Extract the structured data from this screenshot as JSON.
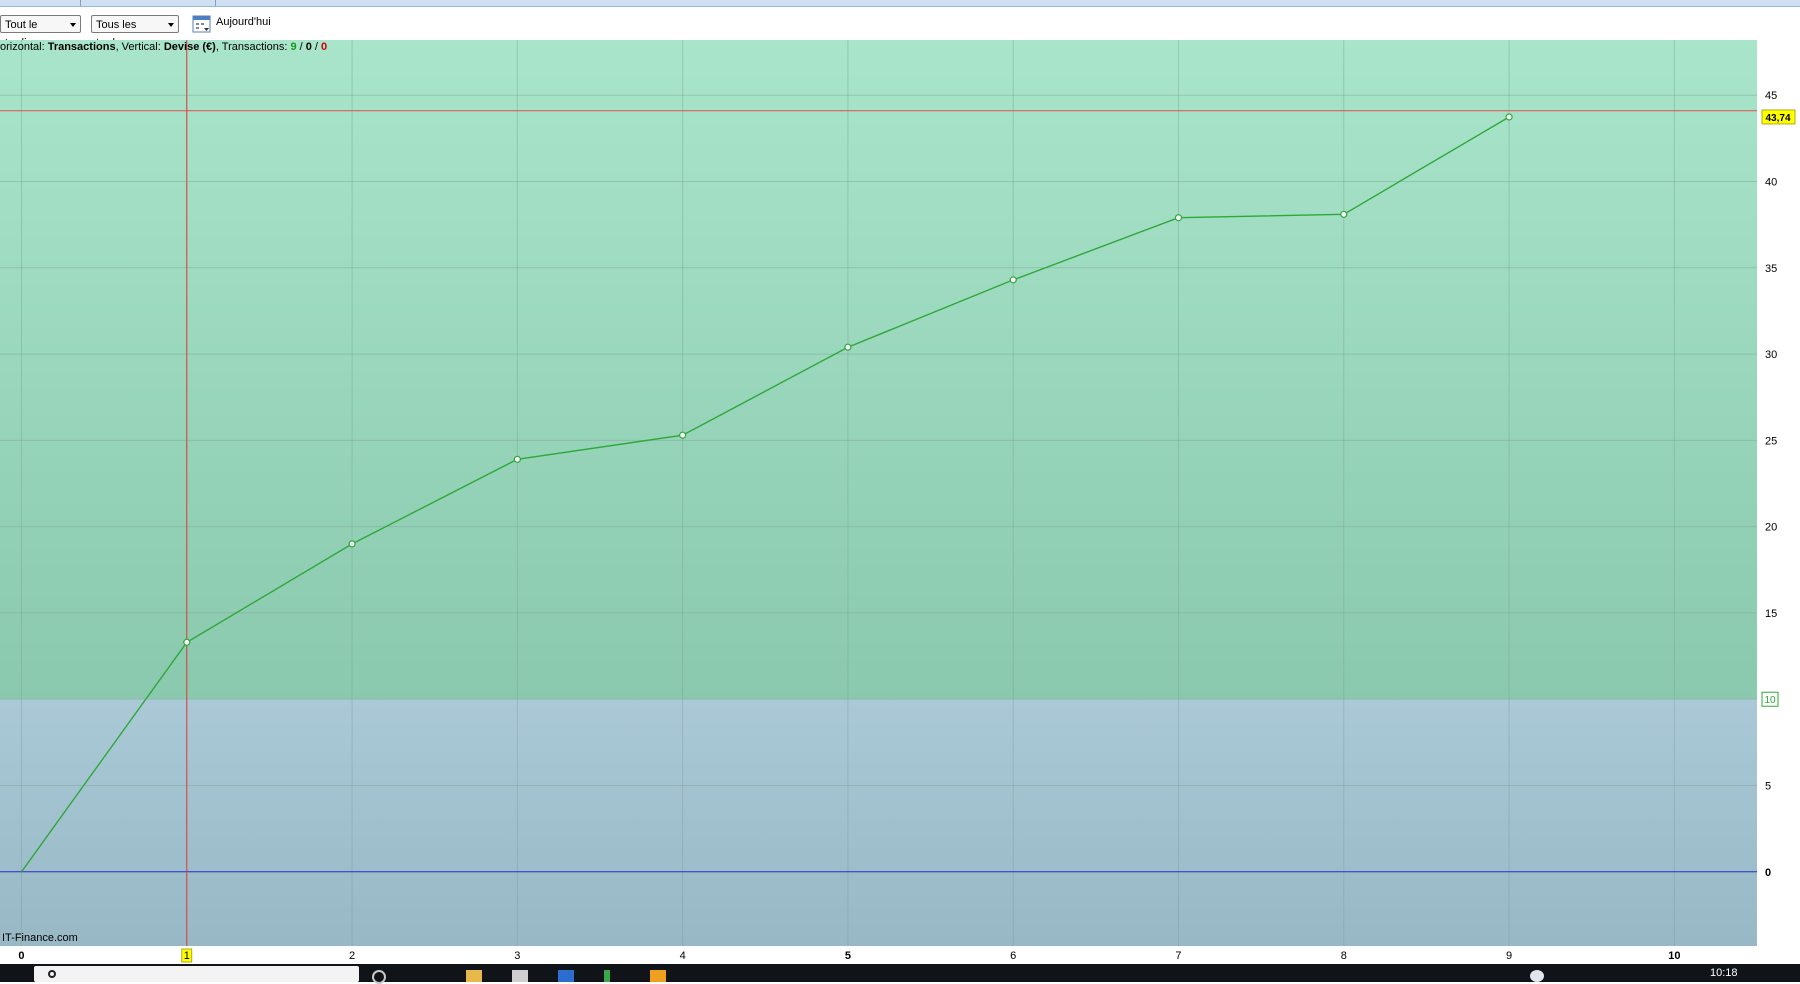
{
  "toolbar": {
    "scope_dropdown": "Tout le trading",
    "trades_dropdown": "Tous les trades",
    "date_label": "Aujourd'hui"
  },
  "chart_info": {
    "prefix": "orizontal: ",
    "horizontal_value": "Transactions",
    "vertical_label": ", Vertical: ",
    "vertical_value": "Devise (€)",
    "transactions_label": ", Transactions: ",
    "count_total": "9",
    "sep1": " / ",
    "count_neutral": "0",
    "sep2": " / ",
    "count_negative": "0"
  },
  "watermark": "IT-Finance.com",
  "colors": {
    "zone_positive_top": "#a9e5cb",
    "zone_positive_bottom": "#8ac9ae",
    "zone_below_top": "#aac9d7",
    "zone_below_bottom": "#98b8c6",
    "series": "#2fa83a",
    "last_value_line": "#e05050",
    "zero_line": "#2233cc",
    "crosshair": "#e03c3c",
    "label_highlight": "#ffff00",
    "positive_count": "#1a9a1a",
    "negative_count": "#cc0000"
  },
  "chart_data": {
    "type": "line",
    "title": "",
    "xlabel": "Transactions",
    "ylabel": "Devise (€)",
    "x": [
      0,
      1,
      2,
      3,
      4,
      5,
      6,
      7,
      8,
      9
    ],
    "values": [
      0,
      13.3,
      19.0,
      23.9,
      25.3,
      30.4,
      34.3,
      37.9,
      38.1,
      43.74
    ],
    "xlim": [
      -0.13,
      10.5
    ],
    "ylim": [
      -4.3,
      48.2
    ],
    "xticks": [
      {
        "value": 0,
        "label": "0",
        "bold": true
      },
      {
        "value": 1,
        "label": "1",
        "highlight": true
      },
      {
        "value": 2,
        "label": "2"
      },
      {
        "value": 3,
        "label": "3"
      },
      {
        "value": 4,
        "label": "4"
      },
      {
        "value": 5,
        "label": "5",
        "bold": true
      },
      {
        "value": 6,
        "label": "6"
      },
      {
        "value": 7,
        "label": "7"
      },
      {
        "value": 8,
        "label": "8"
      },
      {
        "value": 9,
        "label": "9"
      },
      {
        "value": 10,
        "label": "10",
        "bold": true
      }
    ],
    "yticks": [
      {
        "value": 0,
        "label": "0",
        "bold": true
      },
      {
        "value": 5,
        "label": "5"
      },
      {
        "value": 15,
        "label": "15"
      },
      {
        "value": 20,
        "label": "20"
      },
      {
        "value": 25,
        "label": "25"
      },
      {
        "value": 30,
        "label": "30"
      },
      {
        "value": 35,
        "label": "35"
      },
      {
        "value": 40,
        "label": "40"
      },
      {
        "value": 45,
        "label": "45"
      }
    ],
    "threshold": {
      "value": 10,
      "label": "10"
    },
    "last_value": {
      "value": 43.74,
      "label": "43,74",
      "line_value": 44.1
    },
    "crosshair_x": 1,
    "grid": true
  },
  "taskbar": {
    "clock": "10:18"
  }
}
